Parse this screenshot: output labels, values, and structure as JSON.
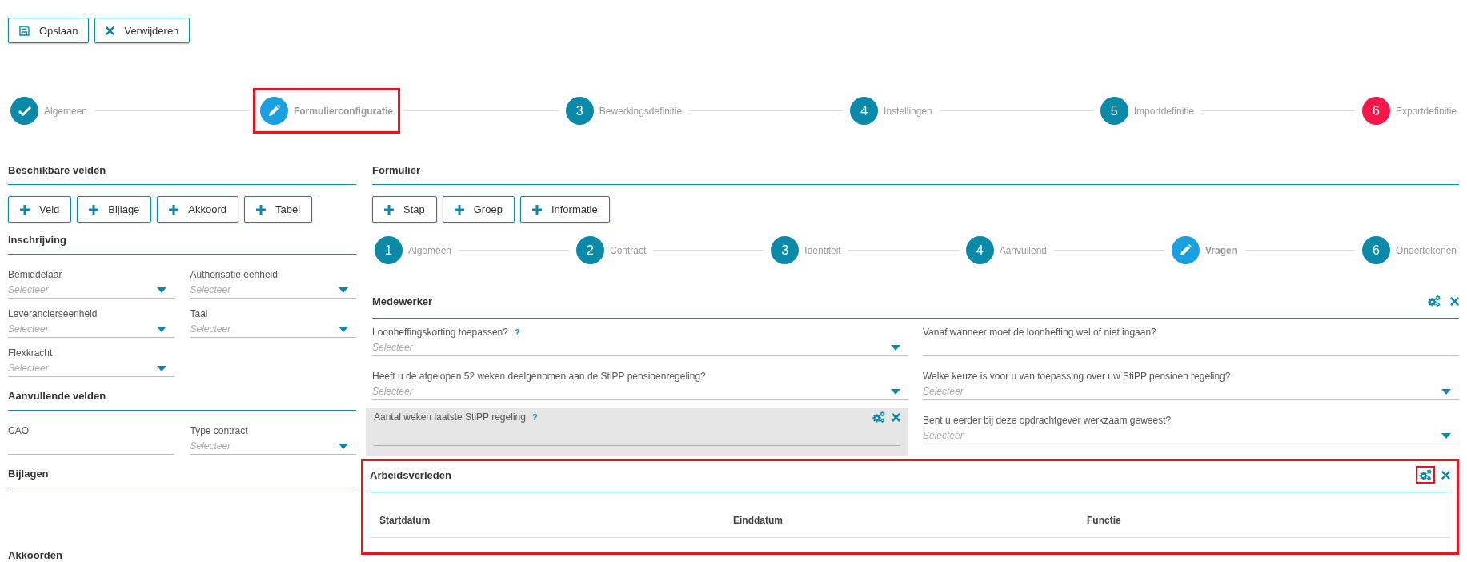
{
  "toolbar": [
    {
      "kind": "save",
      "label": "Opslaan"
    },
    {
      "kind": "delete",
      "label": "Verwijderen"
    }
  ],
  "steps": [
    {
      "kind": "done",
      "label": "Algemeen",
      "selected": false,
      "highlighted": false
    },
    {
      "kind": "edit",
      "label": "Formulierconfiguratie",
      "selected": true,
      "highlighted": true
    },
    {
      "kind": "number",
      "number": "3",
      "label": "Bewerkingsdefinitie",
      "selected": false,
      "highlighted": false
    },
    {
      "kind": "number",
      "number": "4",
      "label": "Instellingen",
      "selected": false,
      "highlighted": false
    },
    {
      "kind": "number",
      "number": "5",
      "label": "Importdefinitie",
      "selected": false,
      "highlighted": false
    },
    {
      "kind": "error",
      "number": "6",
      "label": "Exportdefinitie",
      "selected": false,
      "highlighted": false
    }
  ],
  "available": {
    "title": "Beschikbare velden",
    "buttons": [
      "Veld",
      "Bijlage",
      "Akkoord",
      "Tabel"
    ],
    "groups": [
      {
        "title": "Inschrijving",
        "fields": [
          {
            "kind": "select",
            "label": "Bemiddelaar",
            "placeholder": "Selecteer"
          },
          {
            "kind": "select",
            "label": "Authorisatie eenheid",
            "placeholder": "Selecteer"
          },
          {
            "kind": "select",
            "label": "Leverancierseenheid",
            "placeholder": "Selecteer"
          },
          {
            "kind": "select",
            "label": "Taal",
            "placeholder": "Selecteer"
          },
          {
            "kind": "select",
            "label": "Flexkracht",
            "placeholder": "Selecteer"
          }
        ]
      },
      {
        "title": "Aanvullende velden",
        "fields": [
          {
            "kind": "text",
            "label": "CAO"
          },
          {
            "kind": "select",
            "label": "Type contract",
            "placeholder": "Selecteer"
          }
        ]
      },
      {
        "title": "Bijlagen"
      },
      {
        "title": "Akkoorden"
      }
    ]
  },
  "form": {
    "title": "Formulier",
    "buttons": [
      "Stap",
      "Groep",
      "Informatie"
    ],
    "steps": [
      {
        "kind": "number",
        "number": "1",
        "label": "Algemeen",
        "selected": false,
        "highlighted": false
      },
      {
        "kind": "number",
        "number": "2",
        "label": "Contract",
        "selected": false,
        "highlighted": false
      },
      {
        "kind": "number",
        "number": "3",
        "label": "Identiteit",
        "selected": false,
        "highlighted": false
      },
      {
        "kind": "number",
        "number": "4",
        "label": "Aanvullend",
        "selected": false,
        "highlighted": false
      },
      {
        "kind": "edit",
        "label": "Vragen",
        "selected": true,
        "highlighted": false
      },
      {
        "kind": "number",
        "number": "6",
        "label": "Ondertekenen",
        "selected": false,
        "highlighted": false
      }
    ],
    "sections": [
      {
        "kind": "fields",
        "title": "Medewerker",
        "highlighted": false,
        "settings_highlighted": false,
        "fields": [
          {
            "kind": "select",
            "label": "Loonheffingskorting toepassen?",
            "help": "?",
            "placeholder": "Selecteer",
            "selected": false
          },
          {
            "kind": "text",
            "label": "Vanaf wanneer moet de loonheffing wel of niet ingaan?",
            "selected": false
          },
          {
            "kind": "select",
            "label": "Heeft u de afgelopen 52 weken deelgenomen aan de StiPP pensioenregeling?",
            "placeholder": "Selecteer",
            "selected": false
          },
          {
            "kind": "select",
            "label": "Welke keuze is voor u van toepassing over uw StiPP pensioen regeling?",
            "placeholder": "Selecteer",
            "selected": false
          },
          {
            "kind": "text",
            "label": "Aantal weken laatste StiPP regeling",
            "help": "?",
            "selected": true
          },
          {
            "kind": "select",
            "label": "Bent u eerder bij deze opdrachtgever werkzaam geweest?",
            "placeholder": "Selecteer",
            "selected": false
          }
        ]
      },
      {
        "kind": "table",
        "title": "Arbeidsverleden",
        "highlighted": true,
        "settings_highlighted": true,
        "columns": [
          "Startdatum",
          "Einddatum",
          "Functie"
        ]
      }
    ]
  }
}
